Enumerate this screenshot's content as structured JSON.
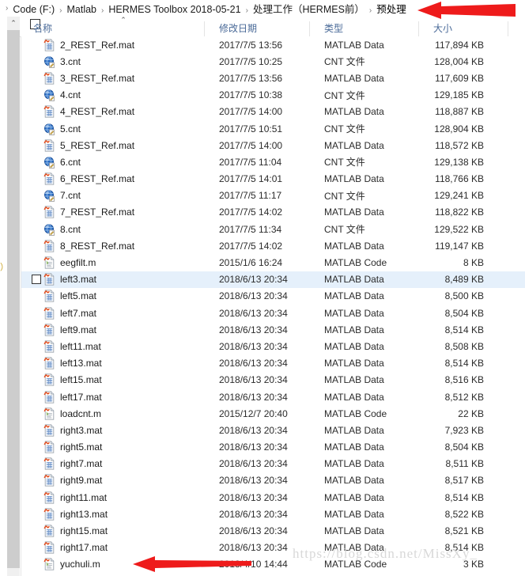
{
  "breadcrumb": {
    "leading_chevron": "›",
    "separator": "›",
    "items": [
      {
        "label": "Code (F:)"
      },
      {
        "label": "Matlab"
      },
      {
        "label": "HERMES Toolbox 2018-05-21"
      },
      {
        "label": "处理工作（HERMES前）"
      },
      {
        "label": "预处理"
      }
    ]
  },
  "columns": {
    "name": "名称",
    "date_modified": "修改日期",
    "type": "类型",
    "size": "大小",
    "sort_indicator": "⌃"
  },
  "scrollbar": {
    "up_arrow": "⌃"
  },
  "edge_fragment": "）",
  "files": [
    {
      "name": "2_REST_Ref.mat",
      "date": "2017/7/5 13:56",
      "type": "MATLAB Data",
      "size": "117,894 KB",
      "icon": "mat-file-icon",
      "selected": false,
      "checkbox": false
    },
    {
      "name": "3.cnt",
      "date": "2017/7/5 10:25",
      "type": "CNT 文件",
      "size": "128,004 KB",
      "icon": "cnt-file-icon",
      "selected": false,
      "checkbox": false
    },
    {
      "name": "3_REST_Ref.mat",
      "date": "2017/7/5 13:56",
      "type": "MATLAB Data",
      "size": "117,609 KB",
      "icon": "mat-file-icon",
      "selected": false,
      "checkbox": false
    },
    {
      "name": "4.cnt",
      "date": "2017/7/5 10:38",
      "type": "CNT 文件",
      "size": "129,185 KB",
      "icon": "cnt-file-icon",
      "selected": false,
      "checkbox": false
    },
    {
      "name": "4_REST_Ref.mat",
      "date": "2017/7/5 14:00",
      "type": "MATLAB Data",
      "size": "118,887 KB",
      "icon": "mat-file-icon",
      "selected": false,
      "checkbox": false
    },
    {
      "name": "5.cnt",
      "date": "2017/7/5 10:51",
      "type": "CNT 文件",
      "size": "128,904 KB",
      "icon": "cnt-file-icon",
      "selected": false,
      "checkbox": false
    },
    {
      "name": "5_REST_Ref.mat",
      "date": "2017/7/5 14:00",
      "type": "MATLAB Data",
      "size": "118,572 KB",
      "icon": "mat-file-icon",
      "selected": false,
      "checkbox": false
    },
    {
      "name": "6.cnt",
      "date": "2017/7/5 11:04",
      "type": "CNT 文件",
      "size": "129,138 KB",
      "icon": "cnt-file-icon",
      "selected": false,
      "checkbox": false
    },
    {
      "name": "6_REST_Ref.mat",
      "date": "2017/7/5 14:01",
      "type": "MATLAB Data",
      "size": "118,766 KB",
      "icon": "mat-file-icon",
      "selected": false,
      "checkbox": false
    },
    {
      "name": "7.cnt",
      "date": "2017/7/5 11:17",
      "type": "CNT 文件",
      "size": "129,241 KB",
      "icon": "cnt-file-icon",
      "selected": false,
      "checkbox": false
    },
    {
      "name": "7_REST_Ref.mat",
      "date": "2017/7/5 14:02",
      "type": "MATLAB Data",
      "size": "118,822 KB",
      "icon": "mat-file-icon",
      "selected": false,
      "checkbox": false
    },
    {
      "name": "8.cnt",
      "date": "2017/7/5 11:34",
      "type": "CNT 文件",
      "size": "129,522 KB",
      "icon": "cnt-file-icon",
      "selected": false,
      "checkbox": false
    },
    {
      "name": "8_REST_Ref.mat",
      "date": "2017/7/5 14:02",
      "type": "MATLAB Data",
      "size": "119,147 KB",
      "icon": "mat-file-icon",
      "selected": false,
      "checkbox": false
    },
    {
      "name": "eegfilt.m",
      "date": "2015/1/6 16:24",
      "type": "MATLAB Code",
      "size": "8 KB",
      "icon": "m-file-icon",
      "selected": false,
      "checkbox": false
    },
    {
      "name": "left3.mat",
      "date": "2018/6/13 20:34",
      "type": "MATLAB Data",
      "size": "8,489 KB",
      "icon": "mat-file-icon",
      "selected": true,
      "checkbox": true
    },
    {
      "name": "left5.mat",
      "date": "2018/6/13 20:34",
      "type": "MATLAB Data",
      "size": "8,500 KB",
      "icon": "mat-file-icon",
      "selected": false,
      "checkbox": false
    },
    {
      "name": "left7.mat",
      "date": "2018/6/13 20:34",
      "type": "MATLAB Data",
      "size": "8,504 KB",
      "icon": "mat-file-icon",
      "selected": false,
      "checkbox": false
    },
    {
      "name": "left9.mat",
      "date": "2018/6/13 20:34",
      "type": "MATLAB Data",
      "size": "8,514 KB",
      "icon": "mat-file-icon",
      "selected": false,
      "checkbox": false
    },
    {
      "name": "left11.mat",
      "date": "2018/6/13 20:34",
      "type": "MATLAB Data",
      "size": "8,508 KB",
      "icon": "mat-file-icon",
      "selected": false,
      "checkbox": false
    },
    {
      "name": "left13.mat",
      "date": "2018/6/13 20:34",
      "type": "MATLAB Data",
      "size": "8,514 KB",
      "icon": "mat-file-icon",
      "selected": false,
      "checkbox": false
    },
    {
      "name": "left15.mat",
      "date": "2018/6/13 20:34",
      "type": "MATLAB Data",
      "size": "8,516 KB",
      "icon": "mat-file-icon",
      "selected": false,
      "checkbox": false
    },
    {
      "name": "left17.mat",
      "date": "2018/6/13 20:34",
      "type": "MATLAB Data",
      "size": "8,512 KB",
      "icon": "mat-file-icon",
      "selected": false,
      "checkbox": false
    },
    {
      "name": "loadcnt.m",
      "date": "2015/12/7 20:40",
      "type": "MATLAB Code",
      "size": "22 KB",
      "icon": "m-file-icon",
      "selected": false,
      "checkbox": false
    },
    {
      "name": "right3.mat",
      "date": "2018/6/13 20:34",
      "type": "MATLAB Data",
      "size": "7,923 KB",
      "icon": "mat-file-icon",
      "selected": false,
      "checkbox": false
    },
    {
      "name": "right5.mat",
      "date": "2018/6/13 20:34",
      "type": "MATLAB Data",
      "size": "8,504 KB",
      "icon": "mat-file-icon",
      "selected": false,
      "checkbox": false
    },
    {
      "name": "right7.mat",
      "date": "2018/6/13 20:34",
      "type": "MATLAB Data",
      "size": "8,511 KB",
      "icon": "mat-file-icon",
      "selected": false,
      "checkbox": false
    },
    {
      "name": "right9.mat",
      "date": "2018/6/13 20:34",
      "type": "MATLAB Data",
      "size": "8,517 KB",
      "icon": "mat-file-icon",
      "selected": false,
      "checkbox": false
    },
    {
      "name": "right11.mat",
      "date": "2018/6/13 20:34",
      "type": "MATLAB Data",
      "size": "8,514 KB",
      "icon": "mat-file-icon",
      "selected": false,
      "checkbox": false
    },
    {
      "name": "right13.mat",
      "date": "2018/6/13 20:34",
      "type": "MATLAB Data",
      "size": "8,522 KB",
      "icon": "mat-file-icon",
      "selected": false,
      "checkbox": false
    },
    {
      "name": "right15.mat",
      "date": "2018/6/13 20:34",
      "type": "MATLAB Data",
      "size": "8,521 KB",
      "icon": "mat-file-icon",
      "selected": false,
      "checkbox": false
    },
    {
      "name": "right17.mat",
      "date": "2018/6/13 20:34",
      "type": "MATLAB Data",
      "size": "8,514 KB",
      "icon": "mat-file-icon",
      "selected": false,
      "checkbox": false
    },
    {
      "name": "yuchuli.m",
      "date": "2018/4/10 14:44",
      "type": "MATLAB Code",
      "size": "3 KB",
      "icon": "m-file-icon",
      "selected": false,
      "checkbox": false
    }
  ],
  "annotations": [
    {
      "name": "arrow-to-preprocessing-breadcrumb",
      "direction": "left"
    },
    {
      "name": "arrow-to-yuchuli-file",
      "direction": "left"
    }
  ],
  "colors": {
    "selection": "#e5f0fb",
    "header_text": "#4a6a98",
    "arrow_red": "#ee1b1b",
    "scrollbar_track": "#f0f0f0",
    "scrollbar_thumb": "#cdcdcd"
  },
  "watermark": "https://blog.csdn.net/MissXy_"
}
